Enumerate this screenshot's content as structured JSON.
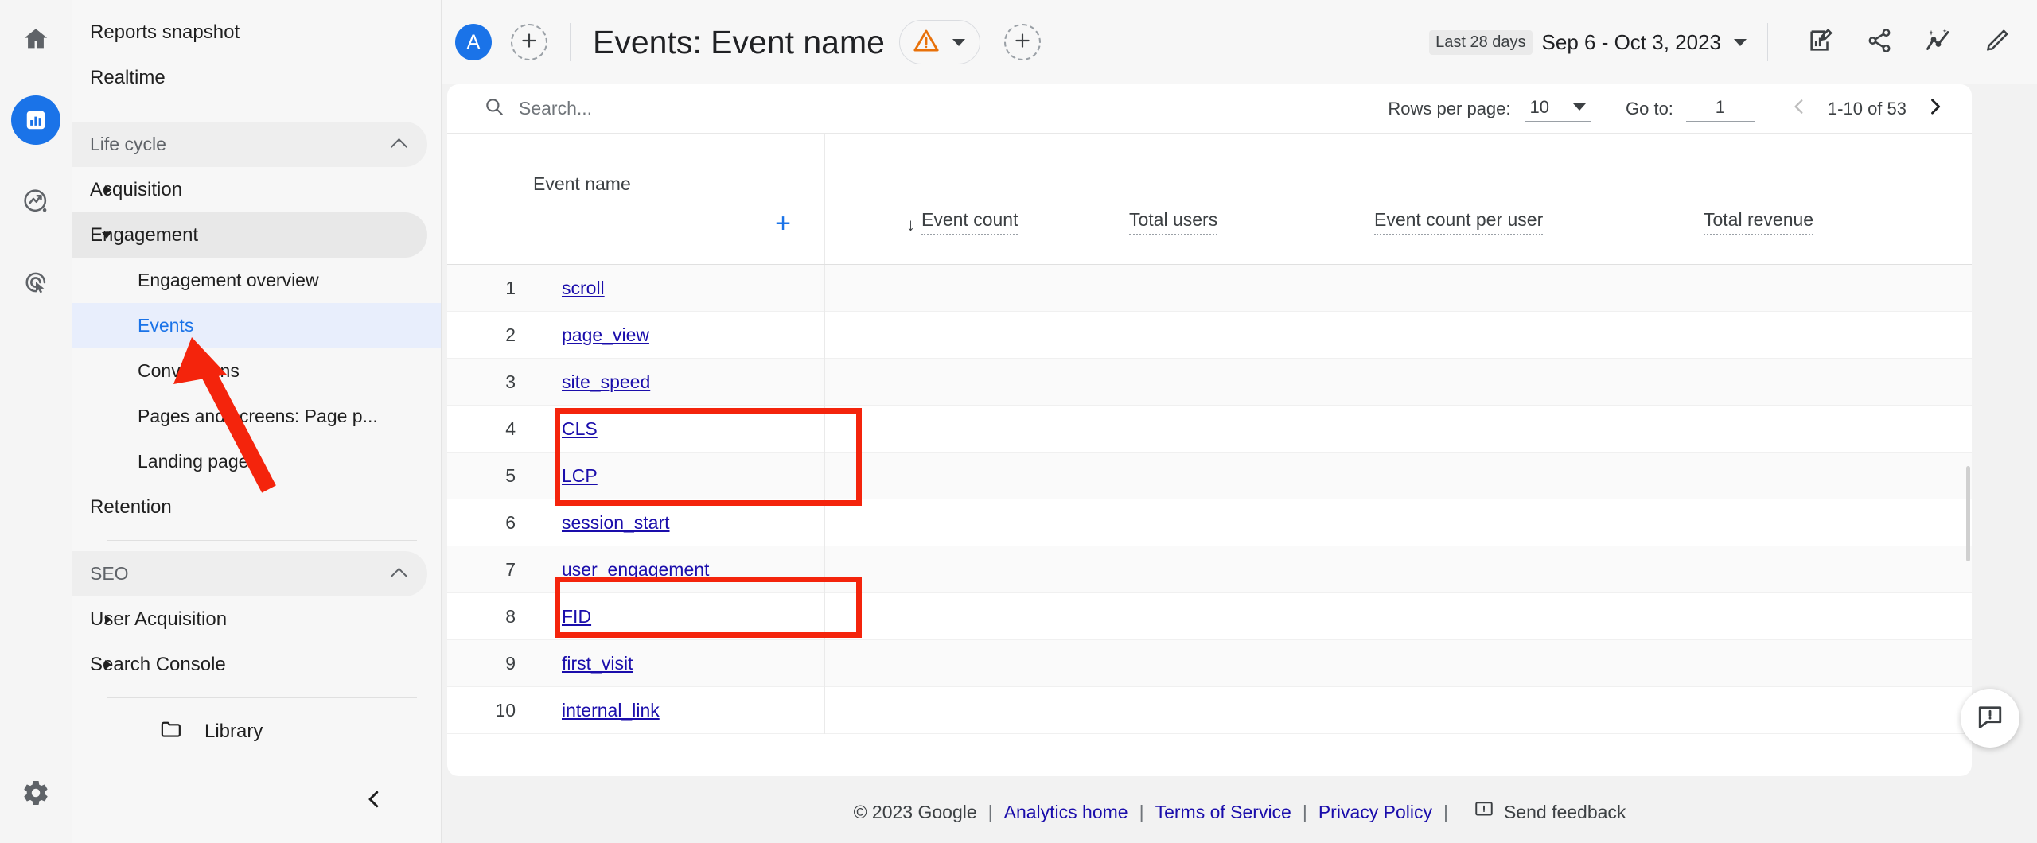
{
  "rail": {
    "items": [
      {
        "name": "home-icon",
        "label": "Home"
      },
      {
        "name": "reports-icon",
        "label": "Reports"
      },
      {
        "name": "explore-icon",
        "label": "Explore"
      },
      {
        "name": "advertising-icon",
        "label": "Advertising"
      }
    ],
    "settings_label": "Admin"
  },
  "sidebar": {
    "top_items": [
      {
        "label": "Reports snapshot"
      },
      {
        "label": "Realtime"
      }
    ],
    "sections": [
      {
        "label": "Life cycle",
        "collapse_icon": "chevron-up-icon",
        "groups": [
          {
            "label": "Acquisition",
            "expanded": false,
            "children": []
          },
          {
            "label": "Engagement",
            "expanded": true,
            "children": [
              {
                "label": "Engagement overview",
                "selected": false
              },
              {
                "label": "Events",
                "selected": true
              },
              {
                "label": "Conversions",
                "selected": false
              },
              {
                "label": "Pages and screens: Page p...",
                "selected": false
              },
              {
                "label": "Landing page",
                "selected": false
              }
            ]
          },
          {
            "label": "Retention",
            "expanded": false,
            "children": []
          }
        ]
      },
      {
        "label": "SEO",
        "collapse_icon": "chevron-up-icon",
        "groups": [
          {
            "label": "User Acquisition",
            "expanded": false,
            "children": []
          },
          {
            "label": "Search Console",
            "expanded": false,
            "children": []
          }
        ]
      }
    ],
    "library": {
      "label": "Library",
      "icon": "folder-icon"
    },
    "collapse_button": {
      "name": "collapse-sidebar-button",
      "icon": "chevron-left-icon"
    }
  },
  "header": {
    "account_badge": "A",
    "add_comparison_label": "+",
    "title": "Events: Event name",
    "warning_icon": "warning-triangle-icon",
    "warning_dropdown_icon": "chevron-down-icon",
    "add_button_label": "+",
    "date_chip": "Last 28 days",
    "date_range": "Sep 6 - Oct 3, 2023",
    "date_dropdown_icon": "chevron-down-icon",
    "actions": [
      {
        "name": "edit-comparison-icon",
        "label": "Customize report"
      },
      {
        "name": "share-icon",
        "label": "Share this report"
      },
      {
        "name": "insights-icon",
        "label": "Insights"
      },
      {
        "name": "pencil-icon",
        "label": "Edit"
      }
    ]
  },
  "toolbar": {
    "search_placeholder": "Search...",
    "search_value": "",
    "search_icon": "search-icon",
    "rows_per_page_label": "Rows per page:",
    "rows_per_page_value": "10",
    "goto_label": "Go to:",
    "goto_value": "1",
    "range_text": "1-10 of 53",
    "prev_icon": "chevron-left-icon",
    "next_icon": "chevron-right-icon"
  },
  "table": {
    "dimension_header": "Event name",
    "add_dimension_label": "+",
    "metrics": [
      {
        "label": "Event count",
        "sorted": true,
        "sort_icon": "arrow-down-icon"
      },
      {
        "label": "Total users",
        "sorted": false
      },
      {
        "label": "Event count per user",
        "sorted": false
      },
      {
        "label": "Total revenue",
        "sorted": false
      }
    ],
    "rows": [
      {
        "index": "1",
        "event_name": "scroll"
      },
      {
        "index": "2",
        "event_name": "page_view"
      },
      {
        "index": "3",
        "event_name": "site_speed"
      },
      {
        "index": "4",
        "event_name": "CLS"
      },
      {
        "index": "5",
        "event_name": "LCP"
      },
      {
        "index": "6",
        "event_name": "session_start"
      },
      {
        "index": "7",
        "event_name": "user_engagement"
      },
      {
        "index": "8",
        "event_name": "FID"
      },
      {
        "index": "9",
        "event_name": "first_visit"
      },
      {
        "index": "10",
        "event_name": "internal_link"
      }
    ]
  },
  "annotations": {
    "highlight_color": "#f4240c",
    "boxes": [
      {
        "name": "highlight-box-cls-lcp",
        "covers": [
          "CLS",
          "LCP"
        ]
      },
      {
        "name": "highlight-box-fid",
        "covers": [
          "FID"
        ]
      }
    ],
    "arrow": {
      "name": "pointer-arrow",
      "points_to": "Events"
    }
  },
  "footer": {
    "copyright": "© 2023 Google",
    "links": [
      {
        "label": "Analytics home"
      },
      {
        "label": "Terms of Service"
      },
      {
        "label": "Privacy Policy"
      }
    ],
    "send_feedback": "Send feedback",
    "feedback_icon": "feedback-icon"
  },
  "fab": {
    "name": "feedback-fab",
    "icon": "feedback-icon"
  }
}
